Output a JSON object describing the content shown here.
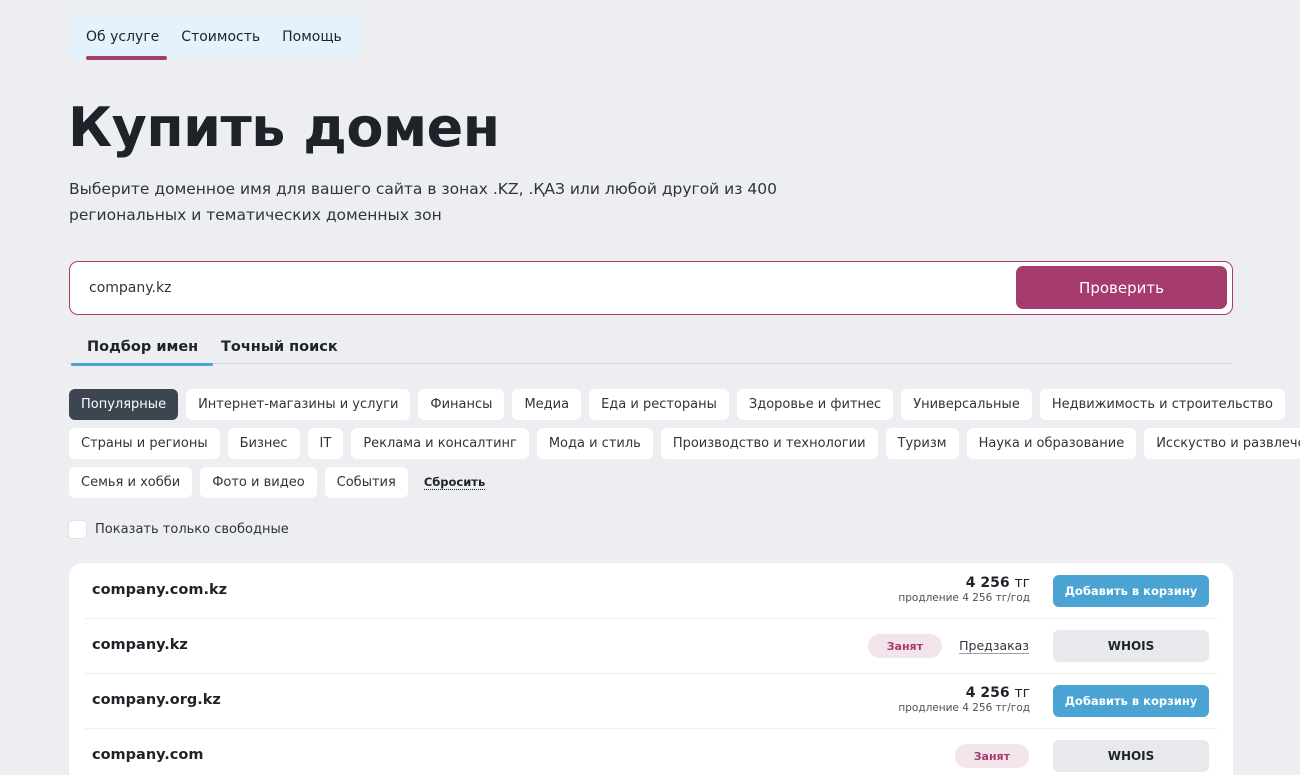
{
  "nav": {
    "items": [
      {
        "label": "Об услуге"
      },
      {
        "label": "Стоимость"
      },
      {
        "label": "Помощь"
      }
    ]
  },
  "page": {
    "title": "Купить домен",
    "subtitle": "Выберите доменное имя для вашего сайта в зонах .KZ, .ҚАЗ или любой другой из 400 региональных и тематических доменных зон"
  },
  "search": {
    "value": "company.kz",
    "button_label": "Проверить"
  },
  "tabs": [
    {
      "label": "Подбор имен"
    },
    {
      "label": "Точный поиск"
    }
  ],
  "categories": {
    "row1": [
      "Популярные",
      "Интернет-магазины и услуги",
      "Финансы",
      "Медиа",
      "Еда и рестораны",
      "Здоровье и фитнес",
      "Универсальные",
      "Недвижимость и строительство"
    ],
    "row2": [
      "Страны и регионы",
      "Бизнес",
      "IT",
      "Реклама и консалтинг",
      "Мода и стиль",
      "Производство и технологии",
      "Туризм",
      "Наука и образование",
      "Исскуство и развлечения"
    ],
    "row3": [
      "Семья и хобби",
      "Фото и видео",
      "События"
    ],
    "reset_label": "Сбросить"
  },
  "filter": {
    "free_only_label": "Показать только свободные"
  },
  "results": [
    {
      "domain": "company.com.kz",
      "price": "4 256",
      "currency": "тг",
      "renewal": "продление 4 256 тг/год",
      "action": "Добавить в корзину"
    },
    {
      "domain": "company.kz",
      "status": "Занят",
      "preorder": "Предзаказ",
      "action": "WHOIS"
    },
    {
      "domain": "company.org.kz",
      "price": "4 256",
      "currency": "тг",
      "renewal": "продление 4 256 тг/год",
      "action": "Добавить в корзину"
    },
    {
      "domain": "company.com",
      "status": "Занят",
      "action": "WHOIS"
    }
  ],
  "colors": {
    "accent": "#a63b6f",
    "blue": "#4aa3d3",
    "background": "#eceef2",
    "chip_active": "#3d4550"
  }
}
